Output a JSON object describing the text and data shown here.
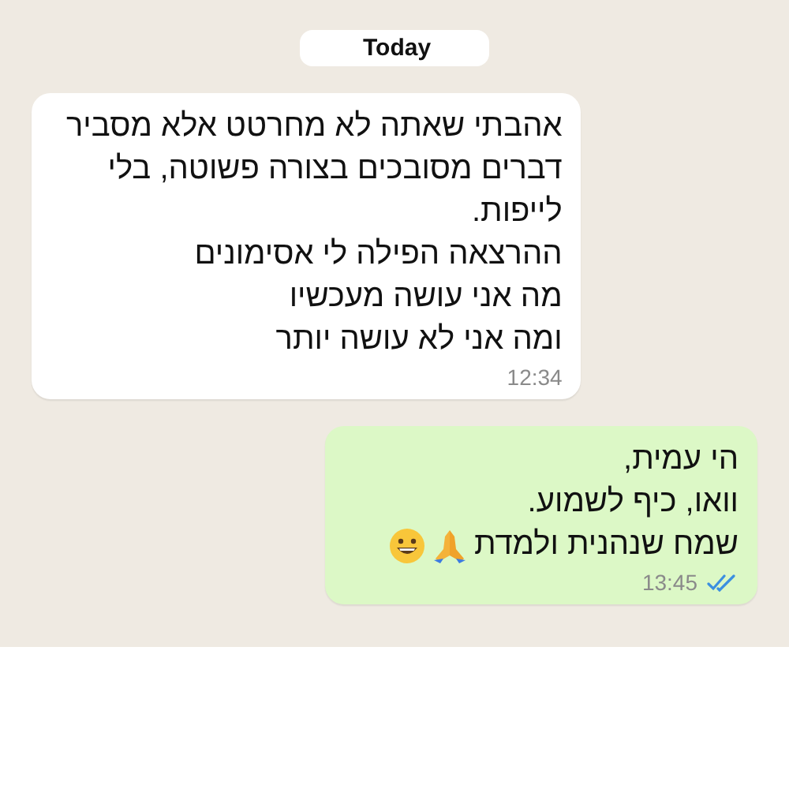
{
  "date_chip": "Today",
  "messages": [
    {
      "kind": "incoming",
      "lines": [
        "אהבתי שאתה לא מחרטט אלא מסביר",
        "דברים מסובכים בצורה פשוטה, בלי",
        "לייפות.",
        "ההרצאה הפילה לי אסימונים",
        "מה אני עושה מעכשיו",
        "ומה אני לא עושה יותר"
      ],
      "time": "12:34"
    },
    {
      "kind": "outgoing",
      "lines": [
        "הי עמית,",
        "וואו, כיף לשמוע.",
        "שמח שנהנית ולמדת"
      ],
      "emojis": [
        {
          "kind": "praying-hands"
        },
        {
          "kind": "grinning-face"
        }
      ],
      "time": "13:45",
      "read": true
    }
  ]
}
